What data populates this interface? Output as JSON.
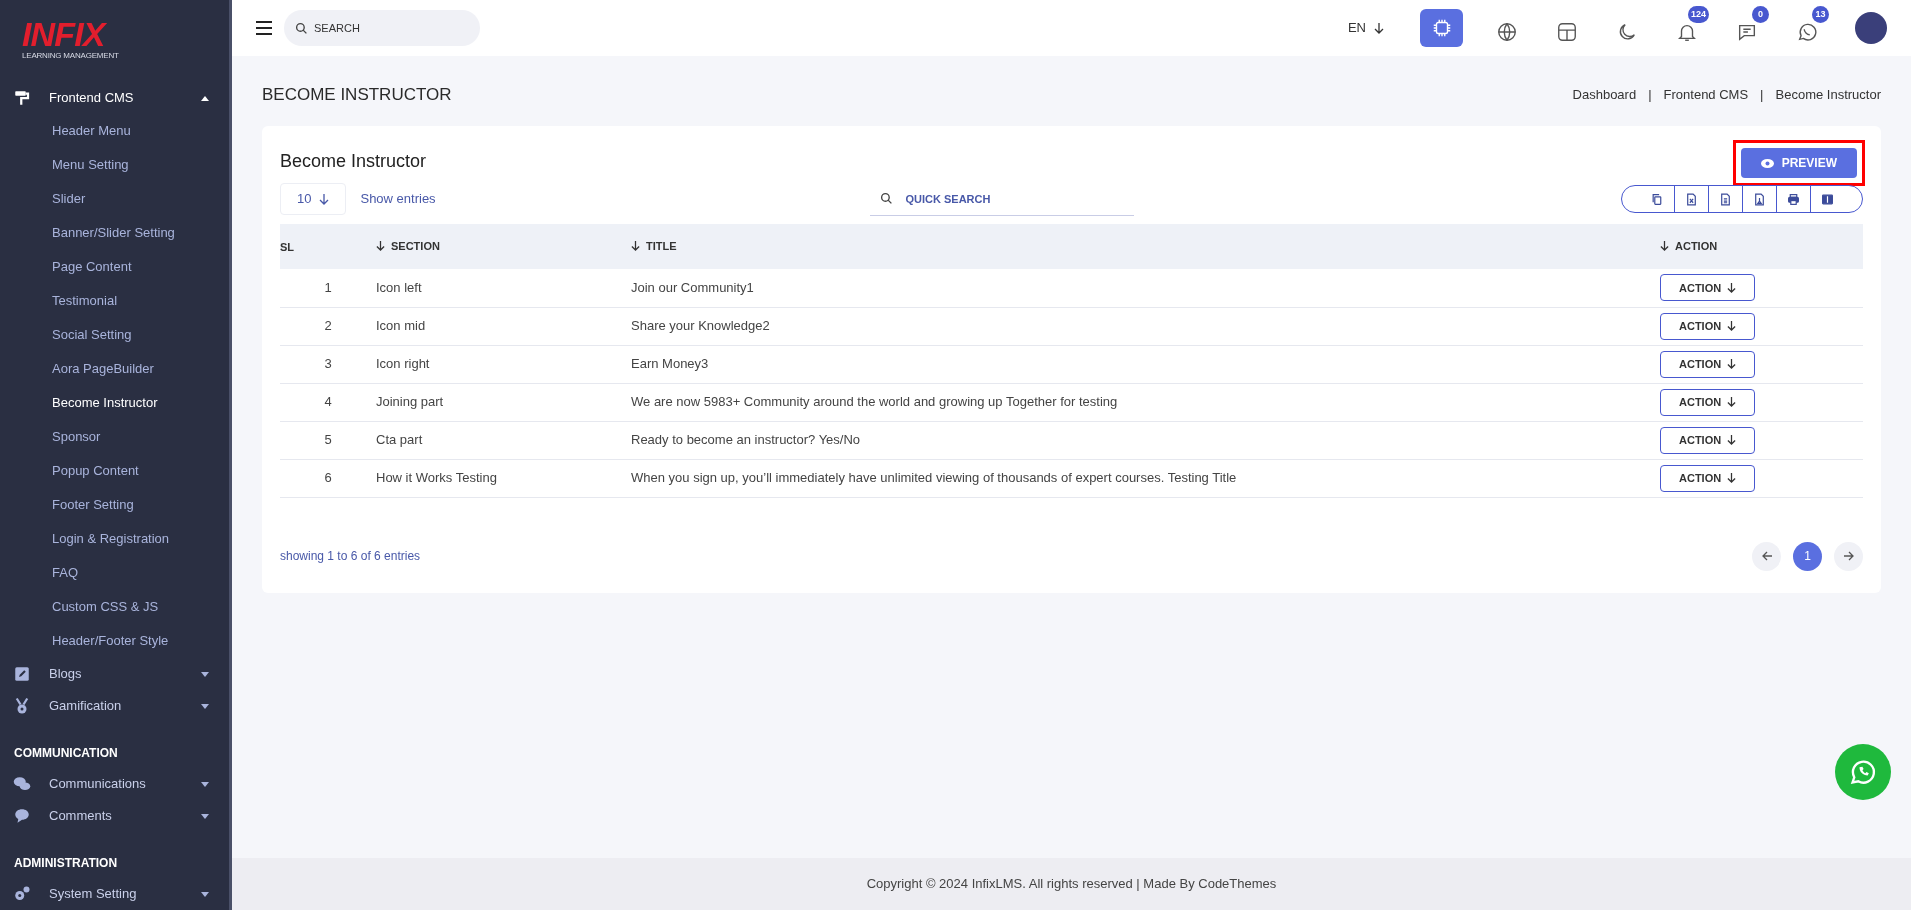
{
  "sidebar": {
    "logo": {
      "title": "INFIX",
      "subtitle": "LEARNING MANAGEMENT"
    },
    "items": [
      {
        "kind": "menu",
        "label": "Frontend CMS",
        "expanded": true,
        "children": [
          {
            "label": "Header Menu",
            "selected": false
          },
          {
            "label": "Menu Setting",
            "selected": false
          },
          {
            "label": "Slider",
            "selected": false
          },
          {
            "label": "Banner/Slider Setting",
            "selected": false
          },
          {
            "label": "Page Content",
            "selected": false
          },
          {
            "label": "Testimonial",
            "selected": false
          },
          {
            "label": "Social Setting",
            "selected": false
          },
          {
            "label": "Aora PageBuilder",
            "selected": false
          },
          {
            "label": "Become Instructor",
            "selected": true
          },
          {
            "label": "Sponsor",
            "selected": false
          },
          {
            "label": "Popup Content",
            "selected": false
          },
          {
            "label": "Footer Setting",
            "selected": false
          },
          {
            "label": "Login & Registration",
            "selected": false
          },
          {
            "label": "FAQ",
            "selected": false
          },
          {
            "label": "Custom CSS & JS",
            "selected": false
          },
          {
            "label": "Header/Footer Style",
            "selected": false
          }
        ]
      },
      {
        "kind": "menu",
        "label": "Blogs",
        "expanded": false
      },
      {
        "kind": "menu",
        "label": "Gamification",
        "expanded": false
      },
      {
        "kind": "heading",
        "label": "COMMUNICATION"
      },
      {
        "kind": "menu",
        "label": "Communications",
        "expanded": false
      },
      {
        "kind": "menu",
        "label": "Comments",
        "expanded": false
      },
      {
        "kind": "heading",
        "label": "ADMINISTRATION"
      },
      {
        "kind": "menu",
        "label": "System Setting",
        "expanded": false
      }
    ]
  },
  "topbar": {
    "search": {
      "placeholder": "SEARCH"
    },
    "language": "EN",
    "icons": [
      {
        "kind": "ai"
      },
      {
        "kind": "globe"
      },
      {
        "kind": "layout"
      },
      {
        "kind": "moon"
      },
      {
        "kind": "bell",
        "badge": "124"
      },
      {
        "kind": "message",
        "badge": "0"
      },
      {
        "kind": "whatsapp",
        "badge": "13"
      }
    ]
  },
  "page": {
    "title": "BECOME INSTRUCTOR",
    "breadcrumb": [
      "Dashboard",
      "|",
      "Frontend CMS",
      "|",
      "Become Instructor"
    ]
  },
  "card": {
    "title": "Become Instructor",
    "preview_button": "PREVIEW",
    "entries": "10",
    "entries_label": "Show entries",
    "search": {
      "placeholder": "QUICK SEARCH"
    },
    "export_buttons": [
      {
        "kind": "copy"
      },
      {
        "kind": "excel"
      },
      {
        "kind": "csv"
      },
      {
        "kind": "pdf"
      },
      {
        "kind": "print"
      },
      {
        "kind": "columns"
      }
    ],
    "table": {
      "columns": [
        {
          "label": "SL",
          "sortable": false
        },
        {
          "label": "SECTION",
          "sortable": true
        },
        {
          "label": "TITLE",
          "sortable": true
        },
        {
          "label": "ACTION",
          "sortable": true
        }
      ],
      "rows": [
        {
          "sl": "1",
          "section": "Icon left",
          "title": "Join our Community1",
          "action": "ACTION"
        },
        {
          "sl": "2",
          "section": "Icon mid",
          "title": "Share your Knowledge2",
          "action": "ACTION"
        },
        {
          "sl": "3",
          "section": "Icon right",
          "title": "Earn Money3",
          "action": "ACTION"
        },
        {
          "sl": "4",
          "section": "Joining part",
          "title": "We are now 5983+ Community around the world and growing up Together for testing",
          "action": "ACTION"
        },
        {
          "sl": "5",
          "section": "Cta part",
          "title": "Ready to become an instructor? Yes/No",
          "action": "ACTION"
        },
        {
          "sl": "6",
          "section": "How it Works Testing",
          "title": "When you sign up, you’ll immediately have unlimited viewing of thousands of expert courses. Testing Title",
          "action": "ACTION"
        }
      ]
    },
    "footer_info": "showing 1 to 6 of 6 entries",
    "pages": [
      {
        "label": "1",
        "selected": true
      }
    ]
  },
  "footer": "Copyright © 2024 InfixLMS. All rights reserved | Made By CodeThemes"
}
